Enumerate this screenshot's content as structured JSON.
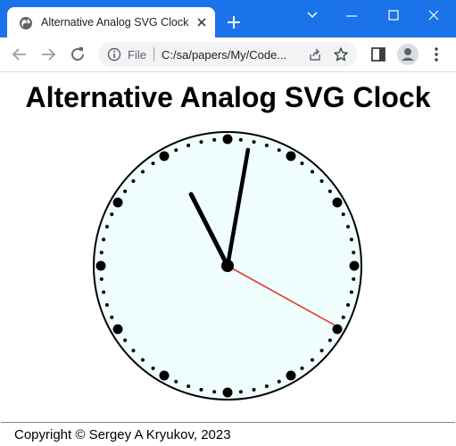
{
  "browser": {
    "tab": {
      "title": "Alternative Analog SVG Clock"
    },
    "omnibox": {
      "scheme_label": "File",
      "url": "C:/sa/papers/My/Code..."
    }
  },
  "page": {
    "title": "Alternative Analog SVG Clock",
    "footer": "Copyright © Sergey A Kryukov, 2023"
  },
  "clock": {
    "face_color": "#f0fdfd",
    "rim_color": "#000000",
    "second_hand_color": "#e53935",
    "hour_hand_angle_deg": 333,
    "minute_hand_angle_deg": 10,
    "second_hand_angle_deg": 119
  },
  "colors": {
    "accent": "#1a73e8"
  }
}
